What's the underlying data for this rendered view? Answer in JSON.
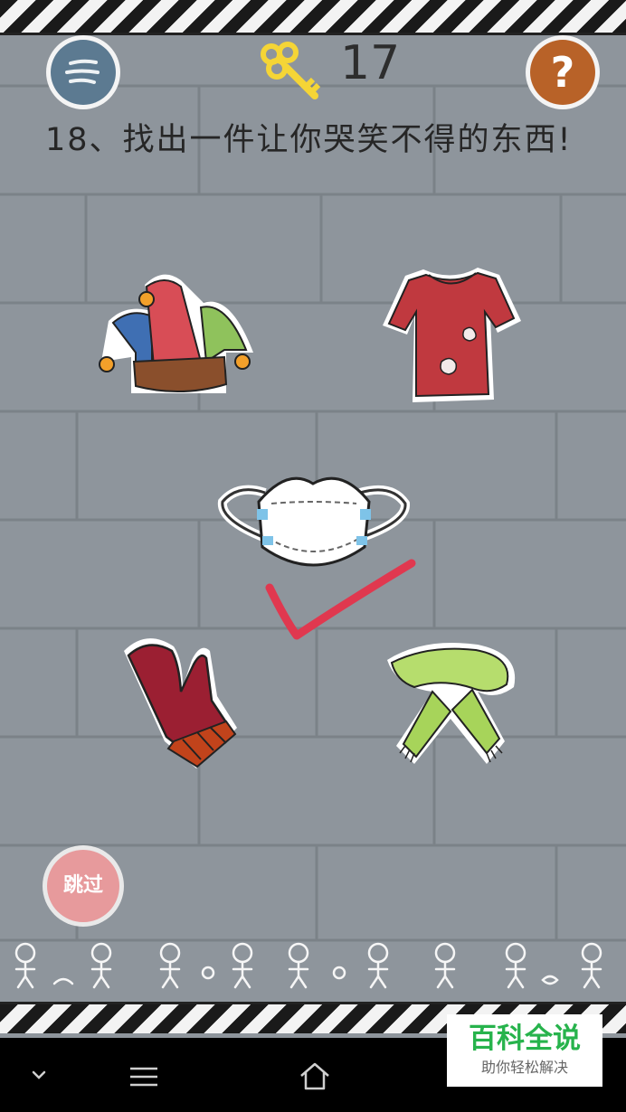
{
  "header": {
    "menu_icon": "menu-lines-icon",
    "key_icon": "key-icon",
    "key_count": "17",
    "help_icon": "question-mark-icon",
    "help_label": "?"
  },
  "question": {
    "text": "18、找出一件让你哭笑不得的东西!"
  },
  "items": [
    {
      "name": "jester-hat",
      "icon": "jester-hat-icon"
    },
    {
      "name": "torn-shirt",
      "icon": "shirt-icon"
    },
    {
      "name": "face-mask",
      "icon": "mask-icon",
      "selected": true
    },
    {
      "name": "mitten",
      "icon": "mitten-icon"
    },
    {
      "name": "scarf",
      "icon": "scarf-icon"
    }
  ],
  "answer_mark": {
    "icon": "checkmark-icon",
    "color": "#e0384f"
  },
  "skip_button": {
    "label": "跳过"
  },
  "navbar": {
    "back_icon": "chevron-down-icon",
    "menu_icon": "menu-icon",
    "home_icon": "home-icon"
  },
  "watermark": {
    "title": "百科全说",
    "subtitle": "助你轻松解决"
  },
  "colors": {
    "background": "#8e959c",
    "accent_red": "#e0384f",
    "watermark_green": "#27b34c"
  }
}
